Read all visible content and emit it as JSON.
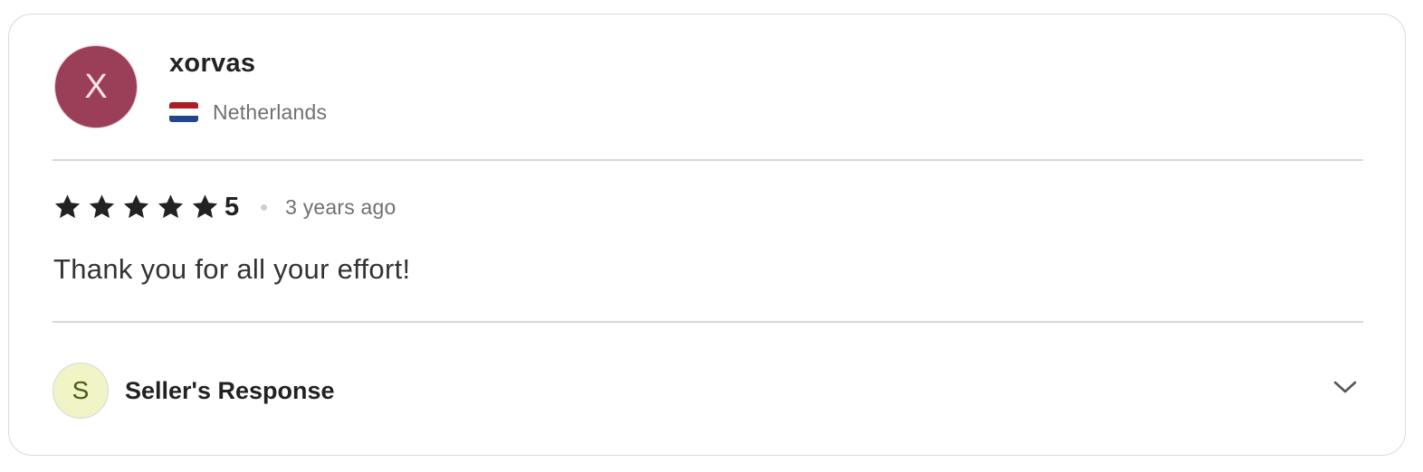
{
  "reviewer": {
    "avatar_initial": "X",
    "avatar_color": "#9b3e57",
    "name": "xorvas",
    "country": "Netherlands",
    "flag_icon": "netherlands-flag-icon",
    "flag_colors": [
      "#ae1c28",
      "#ffffff",
      "#21468b"
    ]
  },
  "rating": {
    "stars": 5,
    "max_stars": 5,
    "value_label": "5",
    "star_icon": "star-icon",
    "star_color": "#222222",
    "time_ago": "3 years ago"
  },
  "review": {
    "text": "Thank you for all your effort!"
  },
  "seller_response": {
    "avatar_initial": "S",
    "avatar_color": "#f0f4c6",
    "label": "Seller's Response",
    "toggle_icon": "chevron-down-icon",
    "expanded": false
  }
}
